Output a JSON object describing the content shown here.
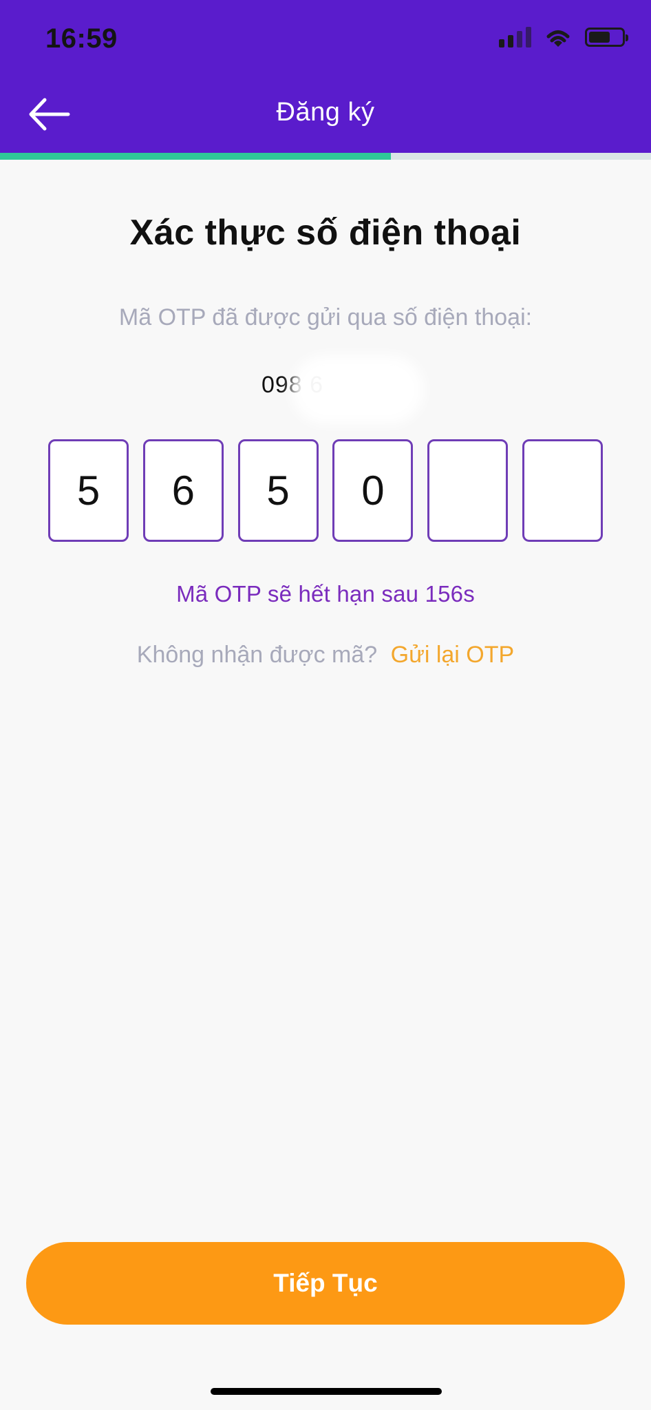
{
  "status_bar": {
    "time": "16:59"
  },
  "header": {
    "title": "Đăng ký",
    "progress_fraction": 0.6,
    "progress_color": "#2fc798",
    "background": "#5a1ccc"
  },
  "icons": {
    "back": "back-arrow-icon",
    "signal": "signal-icon",
    "wifi": "wifi-icon",
    "battery": "battery-icon"
  },
  "main": {
    "title": "Xác thực số điện thoại",
    "instruction": "Mã OTP đã được gửi qua số điện thoại:",
    "phone_number": "098 6",
    "otp_digits": [
      "5",
      "6",
      "5",
      "0",
      "",
      ""
    ],
    "expiry_text": "Mã OTP sẽ hết hạn sau 156s",
    "resend_prompt": "Không nhận được mã?",
    "resend_link": "Gửi lại OTP"
  },
  "actions": {
    "continue_label": "Tiếp Tục",
    "continue_color": "#fd9914"
  }
}
